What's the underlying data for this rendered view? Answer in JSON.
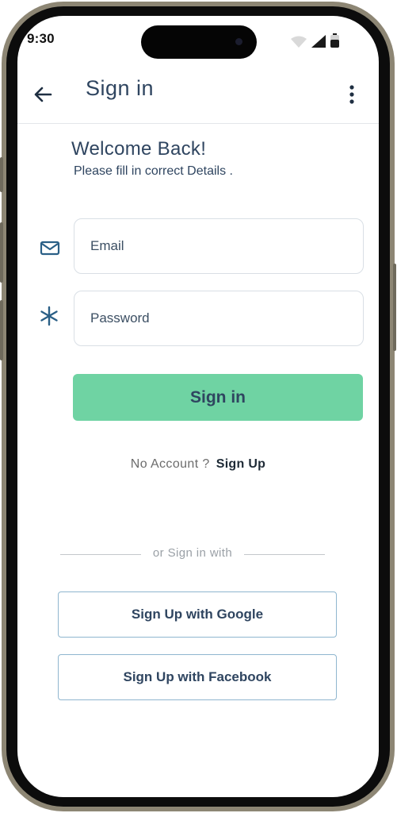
{
  "status_bar": {
    "time": "9:30"
  },
  "app_bar": {
    "title": "Sign in",
    "back_icon": "arrow-left-icon",
    "more_icon": "more-vertical-icon"
  },
  "welcome": {
    "title": "Welcome Back!",
    "subtitle": "Please fill in correct Details ."
  },
  "form": {
    "email_placeholder": "Email",
    "email_value": "",
    "email_icon": "mail-icon",
    "password_placeholder": "Password",
    "password_value": "",
    "password_icon": "asterisk-icon",
    "submit_label": "Sign in"
  },
  "account": {
    "prompt": "No Account ?",
    "signup_link": "Sign Up"
  },
  "social": {
    "divider_text": "or Sign in with",
    "google_label": "Sign Up with Google",
    "facebook_label": "Sign Up with Facebook"
  },
  "colors": {
    "primary_text": "#2f4560",
    "accent_green": "#6fd3a3",
    "social_border": "#8fb6cf",
    "icon_blue": "#2a5f86"
  }
}
